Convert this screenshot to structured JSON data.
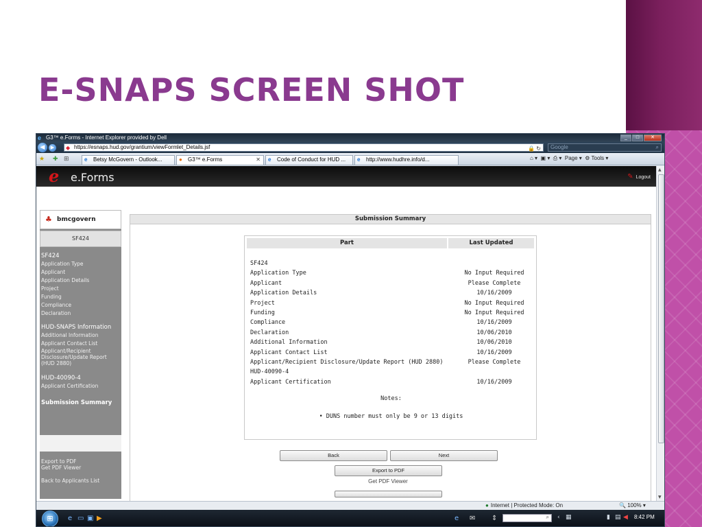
{
  "slide": {
    "title": "E-SNAPS SCREEN SHOT"
  },
  "browser": {
    "window_title": "G3™ e.Forms - Internet Explorer provided by Dell",
    "url": "https://esnaps.hud.gov/grantium/viewFormlet_Details.jsf",
    "search_placeholder": "Google",
    "tabs": [
      {
        "label": "Betsy McGovern - Outlook..."
      },
      {
        "label": "G3™ e.Forms"
      },
      {
        "label": "Code of Conduct for HUD ..."
      },
      {
        "label": "http://www.hudhre.info/d..."
      }
    ],
    "command_bar": {
      "page": "Page ▾",
      "tools": "Tools ▾"
    },
    "status": {
      "zone": "Internet | Protected Mode: On",
      "zoom": "100%"
    },
    "taskbar": {
      "clock": "8:42 PM"
    }
  },
  "app": {
    "brand": "e.Forms",
    "logout": "Logout",
    "user": "bmcgovern",
    "sf_button": "SF424",
    "nav": {
      "sf424_heading": "SF424",
      "sf424_items": [
        "Application Type",
        "Applicant",
        "Application Details",
        "Project",
        "Funding",
        "Compliance",
        "Declaration"
      ],
      "hud_heading": "HUD-SNAPS Information",
      "hud_items": [
        "Additional Information",
        "Applicant Contact List",
        "Applicant/Recipient Disclosure/Update Report (HUD 2880)"
      ],
      "h40090_heading": "HUD-40090-4",
      "h40090_items": [
        "Applicant Certification"
      ],
      "summary": "Submission Summary",
      "export_pdf": "Export to PDF",
      "get_pdf": "Get PDF Viewer",
      "back_list": "Back to Applicants List"
    },
    "summary": {
      "title": "Submission Summary",
      "col_part": "Part",
      "col_updated": "Last Updated",
      "rows": [
        {
          "part": "SF424",
          "status": ""
        },
        {
          "part": "Application Type",
          "status": "No Input Required"
        },
        {
          "part": "Applicant",
          "status": "Please Complete"
        },
        {
          "part": "Application Details",
          "status": "10/16/2009"
        },
        {
          "part": "Project",
          "status": "No Input Required"
        },
        {
          "part": "Funding",
          "status": "No Input Required"
        },
        {
          "part": "Compliance",
          "status": "10/16/2009"
        },
        {
          "part": "Declaration",
          "status": "10/06/2010"
        },
        {
          "part": "Additional Information",
          "status": "10/06/2010"
        },
        {
          "part": "Applicant Contact List",
          "status": "10/16/2009"
        },
        {
          "part": "Applicant/Recipient Disclosure/Update Report (HUD 2880)",
          "status": "Please Complete"
        },
        {
          "part": "HUD-40090-4",
          "status": ""
        },
        {
          "part": "Applicant Certification",
          "status": "10/16/2009"
        }
      ],
      "notes_label": "Notes:",
      "note": "DUNS number must only be 9 or 13 digits",
      "back": "Back",
      "next": "Next",
      "export": "Export to PDF",
      "get_viewer": "Get PDF Viewer"
    }
  }
}
